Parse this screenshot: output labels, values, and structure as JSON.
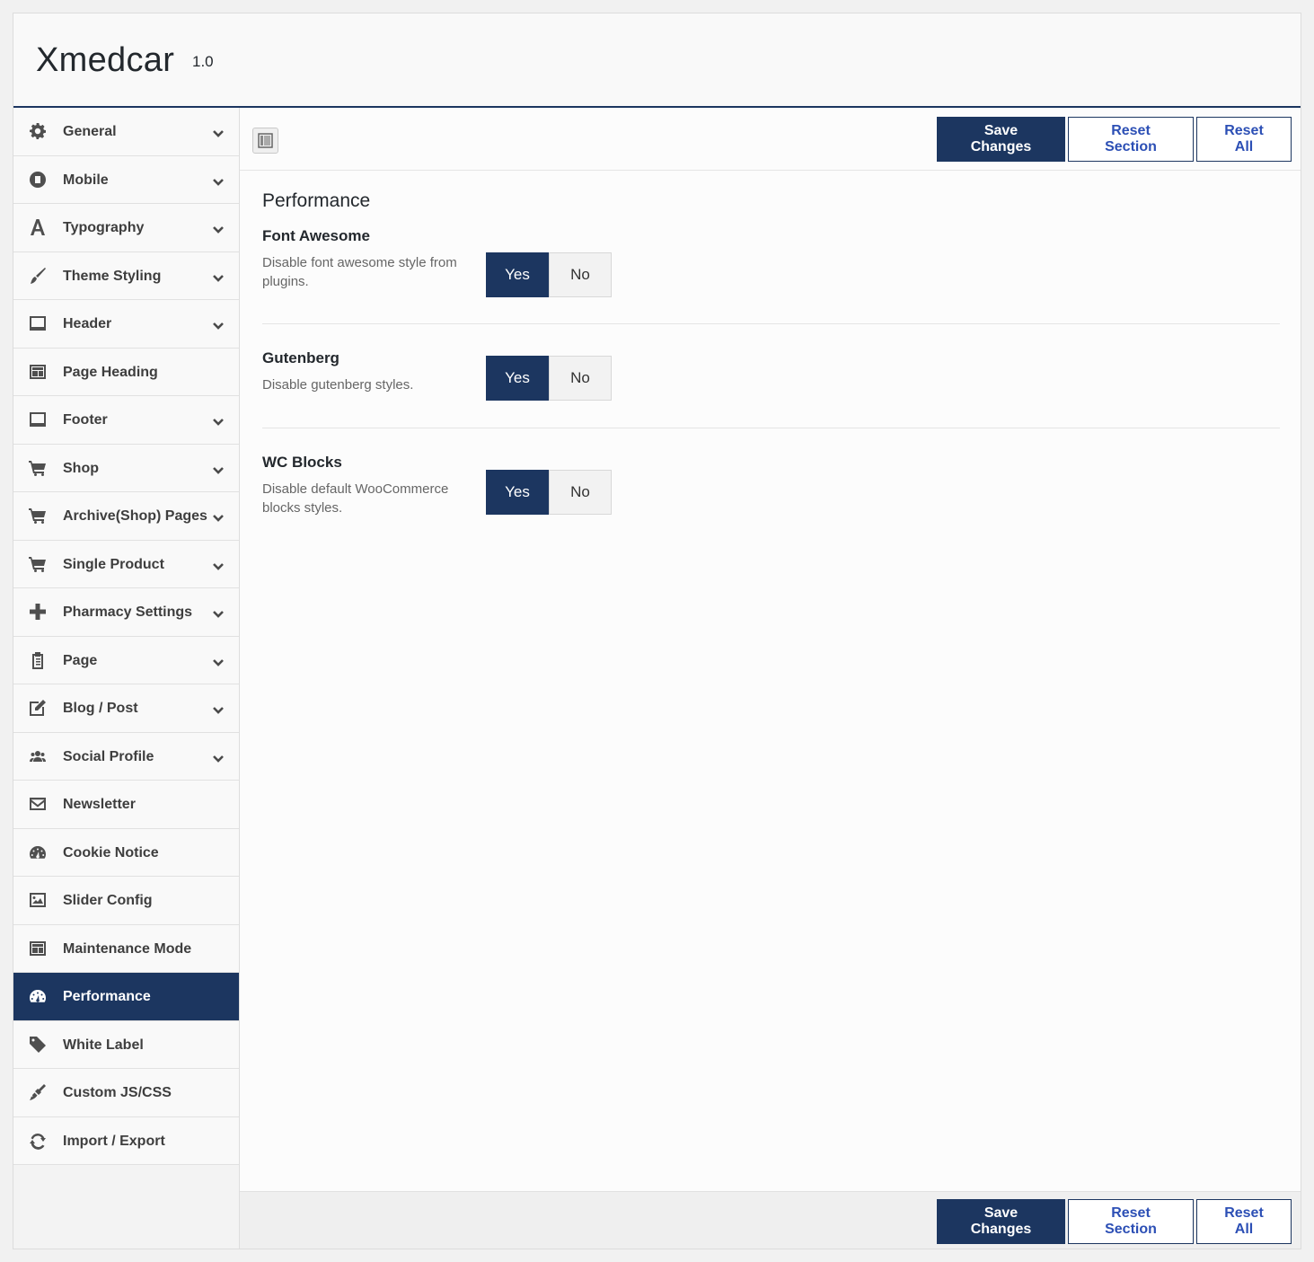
{
  "app": {
    "title": "Xmedcar",
    "version": "1.0"
  },
  "sidebar": {
    "items": [
      {
        "label": "General",
        "icon": "gear-icon",
        "has_chevron": true
      },
      {
        "label": "Mobile",
        "icon": "mobile-icon",
        "has_chevron": true
      },
      {
        "label": "Typography",
        "icon": "font-icon",
        "has_chevron": true
      },
      {
        "label": "Theme Styling",
        "icon": "brush-icon",
        "has_chevron": true
      },
      {
        "label": "Header",
        "icon": "header-icon",
        "has_chevron": true
      },
      {
        "label": "Page Heading",
        "icon": "page-heading-icon",
        "has_chevron": false
      },
      {
        "label": "Footer",
        "icon": "footer-icon",
        "has_chevron": true
      },
      {
        "label": "Shop",
        "icon": "cart-icon",
        "has_chevron": true
      },
      {
        "label": "Archive(Shop) Pages",
        "icon": "cart-icon",
        "has_chevron": true
      },
      {
        "label": "Single Product",
        "icon": "cart-icon",
        "has_chevron": true
      },
      {
        "label": "Pharmacy Settings",
        "icon": "plus-icon",
        "has_chevron": true
      },
      {
        "label": "Page",
        "icon": "clipboard-icon",
        "has_chevron": true
      },
      {
        "label": "Blog / Post",
        "icon": "edit-icon",
        "has_chevron": true
      },
      {
        "label": "Social Profile",
        "icon": "users-icon",
        "has_chevron": true
      },
      {
        "label": "Newsletter",
        "icon": "envelope-icon",
        "has_chevron": false
      },
      {
        "label": "Cookie Notice",
        "icon": "dashboard-icon",
        "has_chevron": false
      },
      {
        "label": "Slider Config",
        "icon": "image-icon",
        "has_chevron": false
      },
      {
        "label": "Maintenance Mode",
        "icon": "page-heading-icon",
        "has_chevron": false
      },
      {
        "label": "Performance",
        "icon": "dashboard-icon",
        "has_chevron": false,
        "active": true
      },
      {
        "label": "White Label",
        "icon": "tag-icon",
        "has_chevron": false
      },
      {
        "label": "Custom JS/CSS",
        "icon": "broom-icon",
        "has_chevron": false
      },
      {
        "label": "Import / Export",
        "icon": "refresh-icon",
        "has_chevron": false
      }
    ]
  },
  "toolbar": {
    "save_label": "Save Changes",
    "reset_section_label": "Reset Section",
    "reset_all_label": "Reset All"
  },
  "section": {
    "title": "Performance",
    "fields": [
      {
        "label": "Font Awesome",
        "description": "Disable font awesome style from plugins.",
        "yes": "Yes",
        "no": "No",
        "value": "Yes"
      },
      {
        "label": "Gutenberg",
        "description": "Disable gutenberg styles.",
        "yes": "Yes",
        "no": "No",
        "value": "Yes"
      },
      {
        "label": "WC Blocks",
        "description": "Disable default WooCommerce blocks styles.",
        "yes": "Yes",
        "no": "No",
        "value": "Yes"
      }
    ]
  },
  "colors": {
    "accent": "#1c3660",
    "link": "#2c4fb5"
  }
}
